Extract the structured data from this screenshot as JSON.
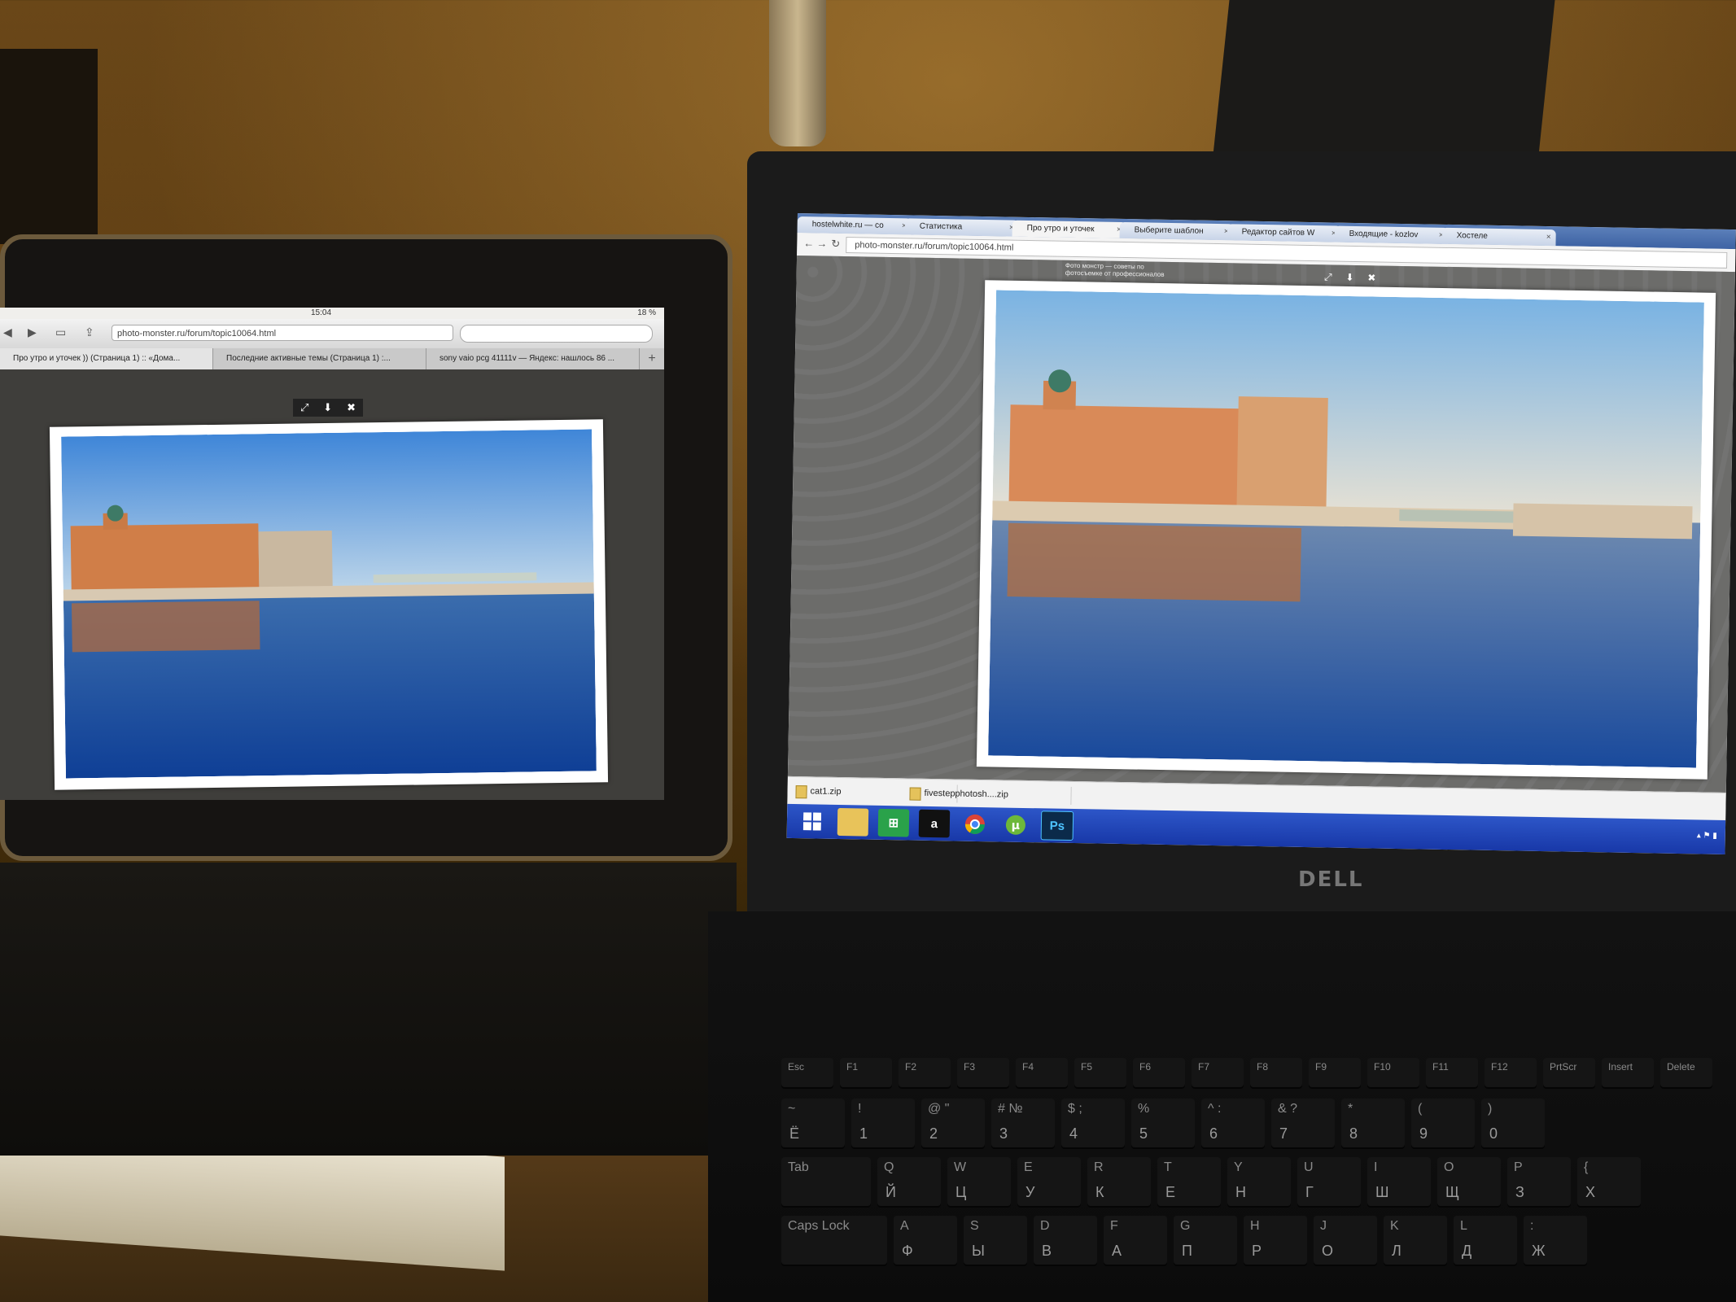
{
  "ipad": {
    "status_time": "15:04",
    "status_battery": "18 %",
    "url": "photo-monster.ru/forum/topic10064.html",
    "tabs": [
      "Про утро и уточек )) (Страница 1) :: «Дома...",
      "Последние активные темы (Страница 1) :...",
      "sony vaio pcg 41111v — Яндекс: нашлось 86 ..."
    ],
    "new_tab": "+",
    "viewer_controls": [
      "⤢",
      "⬇",
      "✖"
    ]
  },
  "laptop": {
    "brand": "DELL",
    "chrome_tabs": [
      "hostelwhite.ru — со",
      "Статистика",
      "Про утро и уточек",
      "Выберите шаблон",
      "Редактор сайтов W",
      "Входящие - kozlov",
      "Хостеле"
    ],
    "url": "photo-monster.ru/forum/topic10064.html",
    "page_header": "Фото монстр — советы по фотосъемке от профессионалов",
    "downloads": [
      "cat1.zip",
      "fivestepphotosh....zip"
    ],
    "taskbar_icons": [
      "windows-start",
      "file-explorer",
      "store",
      "amazon",
      "chrome",
      "utorrent",
      "photoshop"
    ],
    "taskbar_labels": {
      "amazon": "a",
      "photoshop": "Ps"
    }
  },
  "keyboard": {
    "frow": [
      "Esc",
      "F1",
      "F2",
      "F3",
      "F4",
      "F5",
      "F6",
      "F7",
      "F8",
      "F9",
      "F10",
      "F11",
      "F12",
      "PrtScr",
      "Insert",
      "Delete"
    ],
    "numrow": [
      {
        "top": "~",
        "bottom": "Ё"
      },
      {
        "top": "!",
        "bottom": "1"
      },
      {
        "top": "@ \"",
        "bottom": "2"
      },
      {
        "top": "# №",
        "bottom": "3"
      },
      {
        "top": "$ ;",
        "bottom": "4"
      },
      {
        "top": "%",
        "bottom": "5"
      },
      {
        "top": "^ :",
        "bottom": "6"
      },
      {
        "top": "& ?",
        "bottom": "7"
      },
      {
        "top": "*",
        "bottom": "8"
      },
      {
        "top": "(",
        "bottom": "9"
      },
      {
        "top": ")",
        "bottom": "0"
      }
    ],
    "qrow": [
      {
        "top": "Q",
        "bottom": "Й"
      },
      {
        "top": "W",
        "bottom": "Ц"
      },
      {
        "top": "E",
        "bottom": "У"
      },
      {
        "top": "R",
        "bottom": "К"
      },
      {
        "top": "T",
        "bottom": "Е"
      },
      {
        "top": "Y",
        "bottom": "Н"
      },
      {
        "top": "U",
        "bottom": "Г"
      },
      {
        "top": "I",
        "bottom": "Ш"
      },
      {
        "top": "O",
        "bottom": "Щ"
      },
      {
        "top": "P",
        "bottom": "З"
      },
      {
        "top": "{",
        "bottom": "Х"
      }
    ],
    "arow": [
      {
        "top": "A",
        "bottom": "Ф"
      },
      {
        "top": "S",
        "bottom": "Ы"
      },
      {
        "top": "D",
        "bottom": "В"
      },
      {
        "top": "F",
        "bottom": "А"
      },
      {
        "top": "G",
        "bottom": "П"
      },
      {
        "top": "H",
        "bottom": "Р"
      },
      {
        "top": "J",
        "bottom": "О"
      },
      {
        "top": "K",
        "bottom": "Л"
      },
      {
        "top": "L",
        "bottom": "Д"
      },
      {
        "top": ":",
        "bottom": "Ж"
      }
    ],
    "tab_label": "Tab",
    "caps_label": "Caps Lock"
  },
  "colors": {
    "sky_top": "#6aa6de",
    "sky_bottom": "#d8e4ec",
    "water": "#1f4f9a",
    "palace": "#d68b5a",
    "taskbar": "#2448b8"
  }
}
